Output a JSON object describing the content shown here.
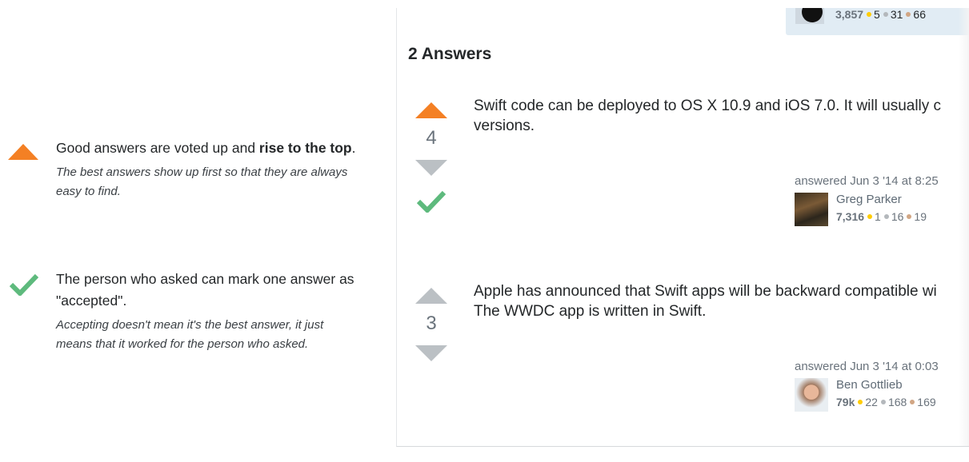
{
  "explainer": {
    "voting": {
      "icon": "up-arrow-icon",
      "headline_pre": "Good answers are voted up and ",
      "headline_bold": "rise to the top",
      "headline_post": ".",
      "detail": "The best answers show up first so that they are always easy to find."
    },
    "accepting": {
      "icon": "checkmark-icon",
      "headline_pre": "The person who asked can mark one answer as \"accepted\".",
      "detail": "Accepting doesn't mean it's the best answer, it just means that it worked for the person who asked."
    }
  },
  "owner": {
    "rep": "3,857",
    "gold": "5",
    "silver": "31",
    "bronze": "66"
  },
  "answers_title": "2 Answers",
  "answers": [
    {
      "score": "4",
      "upvoted": true,
      "accepted": true,
      "body_lines": [
        "Swift code can be deployed to OS X 10.9 and iOS 7.0. It will usually c",
        "versions."
      ],
      "answered": "answered Jun 3 '14 at 8:25",
      "user": {
        "name": "Greg Parker",
        "rep": "7,316",
        "gold": "1",
        "silver": "16",
        "bronze": "19"
      }
    },
    {
      "score": "3",
      "upvoted": false,
      "accepted": false,
      "body_lines": [
        "Apple has announced that Swift apps will be backward compatible wi",
        "The WWDC app is written in Swift."
      ],
      "answered": "answered Jun 3 '14 at 0:03",
      "user": {
        "name": "Ben Gottlieb",
        "rep": "79k",
        "gold": "22",
        "silver": "168",
        "bronze": "169"
      }
    }
  ],
  "colors": {
    "upvote_active": "#f48024",
    "vote_inactive": "#bbc0c4",
    "accepted": "#5eba7d",
    "gold_badge": "#ffcc01",
    "silver_badge": "#b4b8bc",
    "bronze_badge": "#d1a684"
  }
}
